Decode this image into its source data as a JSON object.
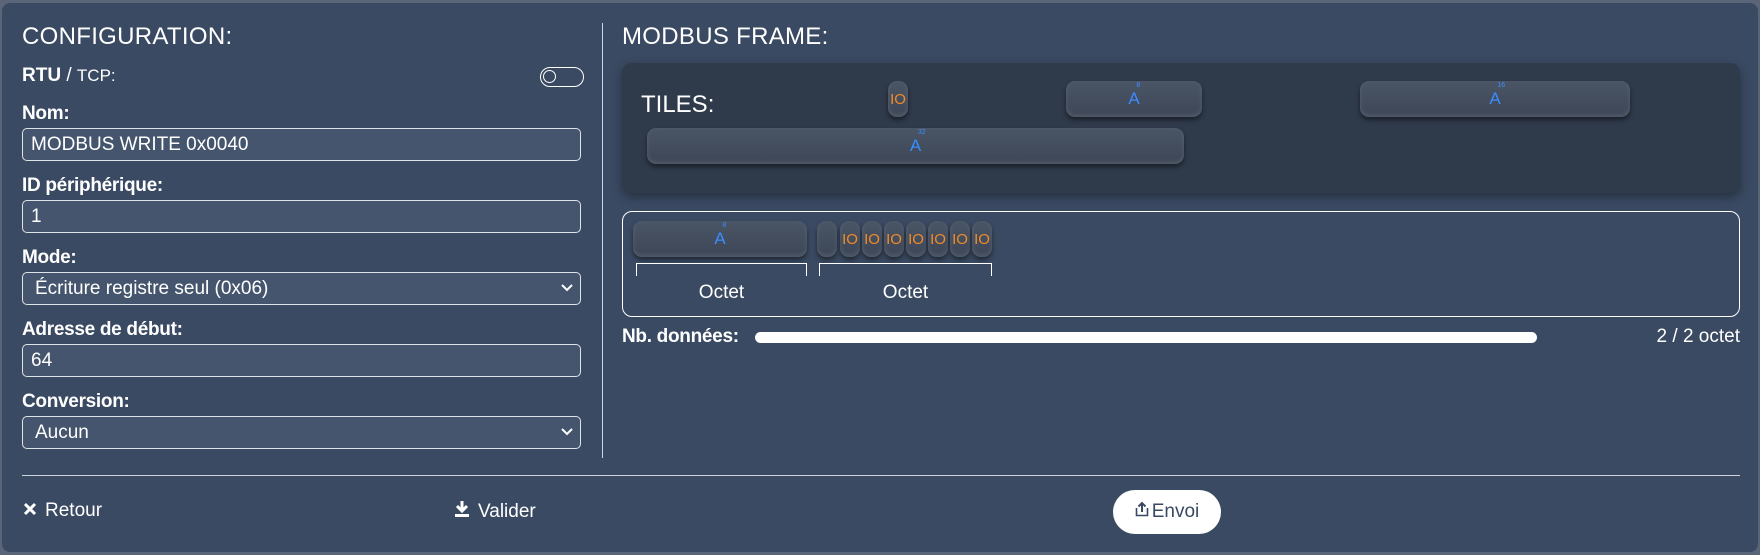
{
  "config": {
    "title": "CONFIGURATION:",
    "protocol_rtu": "RTU",
    "protocol_sep": " / ",
    "protocol_tcp": "TCP:",
    "fields": {
      "name_label": "Nom:",
      "name_value": "MODBUS WRITE 0x0040",
      "device_id_label": "ID périphérique:",
      "device_id_value": "1",
      "mode_label": "Mode:",
      "mode_value": "Écriture registre seul (0x06)",
      "start_address_label": "Adresse de début:",
      "start_address_value": "64",
      "conversion_label": "Conversion:",
      "conversion_value": "Aucun"
    }
  },
  "frame": {
    "title": "MODBUS FRAME:",
    "tiles_label": "TILES:",
    "tiles": [
      {
        "type": "io",
        "label": "IO"
      },
      {
        "type": "a",
        "label": "A",
        "exp": "8"
      },
      {
        "type": "a",
        "label": "A",
        "exp": "16"
      },
      {
        "type": "a",
        "label": "A",
        "exp": "32"
      }
    ],
    "frame_tiles": {
      "a_label": "A",
      "a_exp": "8",
      "io_label": "IO"
    },
    "octet_labels": [
      "Octet",
      "Octet"
    ],
    "nb_label": "Nb. données:",
    "nb_value": "2 / 2 octet",
    "nb_fill": 1.0
  },
  "footer": {
    "back_label": "Retour",
    "validate_label": "Valider",
    "send_label": "Envoi"
  },
  "colors": {
    "panel": "#3a4a62",
    "io_orange": "#f28b2a",
    "a_blue": "#3b8cff"
  }
}
